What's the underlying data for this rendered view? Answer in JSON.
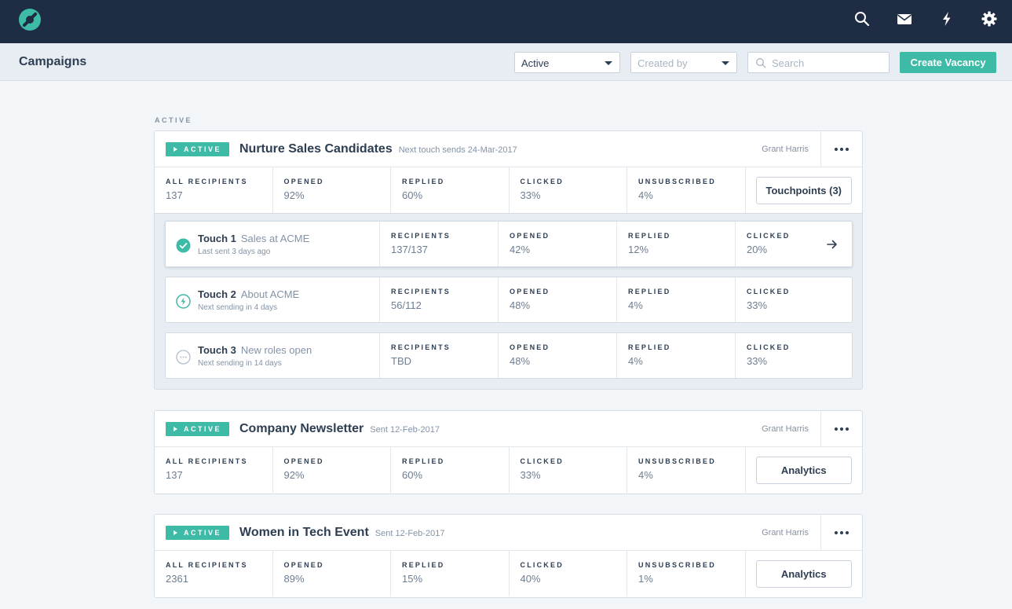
{
  "header": {
    "icons": [
      "logo-icon",
      "search-icon",
      "mail-icon",
      "lightning-icon",
      "gear-icon"
    ]
  },
  "subheader": {
    "title": "Campaigns",
    "status_filter": "Active",
    "created_by_placeholder": "Created by",
    "search_placeholder": "Search",
    "create_button": "Create Vacancy"
  },
  "section_label": "ACTIVE",
  "campaigns": [
    {
      "badge": "ACTIVE",
      "title": "Nurture Sales Candidates",
      "subtitle": "Next touch sends 24-Mar-2017",
      "owner": "Grant Harris",
      "stats": [
        {
          "label": "ALL RECIPIENTS",
          "value": "137"
        },
        {
          "label": "OPENED",
          "value": "92%"
        },
        {
          "label": "REPLIED",
          "value": "60%"
        },
        {
          "label": "CLICKED",
          "value": "33%"
        },
        {
          "label": "UNSUBSCRIBED",
          "value": "4%"
        }
      ],
      "action": "Touchpoints (3)",
      "touches": [
        {
          "title": "Touch 1",
          "subject": "Sales at ACME",
          "note": "Last sent 3 days ago",
          "status_icon": "check-circle-icon",
          "stats": [
            {
              "label": "RECIPIENTS",
              "value": "137/137"
            },
            {
              "label": "OPENED",
              "value": "42%"
            },
            {
              "label": "REPLIED",
              "value": "12%"
            },
            {
              "label": "CLICKED",
              "value": "20%"
            }
          ]
        },
        {
          "title": "Touch 2",
          "subject": "About ACME",
          "note": "Next sending in 4 days",
          "status_icon": "lightning-circle-icon",
          "stats": [
            {
              "label": "RECIPIENTS",
              "value": "56/112"
            },
            {
              "label": "OPENED",
              "value": "48%"
            },
            {
              "label": "REPLIED",
              "value": "4%"
            },
            {
              "label": "CLICKED",
              "value": "33%"
            }
          ]
        },
        {
          "title": "Touch 3",
          "subject": "New roles open",
          "note": "Next sending in 14 days",
          "status_icon": "pending-circle-icon",
          "stats": [
            {
              "label": "RECIPIENTS",
              "value": "TBD"
            },
            {
              "label": "OPENED",
              "value": "48%"
            },
            {
              "label": "REPLIED",
              "value": "4%"
            },
            {
              "label": "CLICKED",
              "value": "33%"
            }
          ]
        }
      ]
    },
    {
      "badge": "ACTIVE",
      "title": "Company Newsletter",
      "subtitle": "Sent 12-Feb-2017",
      "owner": "Grant Harris",
      "stats": [
        {
          "label": "ALL RECIPIENTS",
          "value": "137"
        },
        {
          "label": "OPENED",
          "value": "92%"
        },
        {
          "label": "REPLIED",
          "value": "60%"
        },
        {
          "label": "CLICKED",
          "value": "33%"
        },
        {
          "label": "UNSUBSCRIBED",
          "value": "4%"
        }
      ],
      "action": "Analytics"
    },
    {
      "badge": "ACTIVE",
      "title": "Women in Tech Event",
      "subtitle": "Sent 12-Feb-2017",
      "owner": "Grant Harris",
      "stats": [
        {
          "label": "ALL RECIPIENTS",
          "value": "2361"
        },
        {
          "label": "OPENED",
          "value": "89%"
        },
        {
          "label": "REPLIED",
          "value": "15%"
        },
        {
          "label": "CLICKED",
          "value": "40%"
        },
        {
          "label": "UNSUBSCRIBED",
          "value": "1%"
        }
      ],
      "action": "Analytics"
    }
  ],
  "colors": {
    "topbar": "#1f2d44",
    "accent": "#3dbba6",
    "text": "#2e3e52",
    "muted": "#8393a6"
  }
}
